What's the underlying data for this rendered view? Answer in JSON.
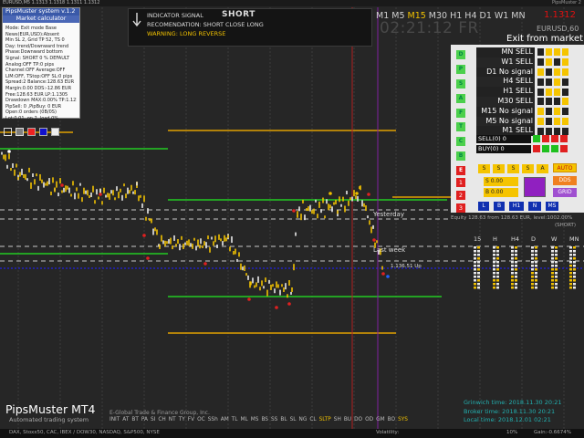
{
  "window": {
    "title_strip": "EURUSD,M5  1.1313 1.1318 1.1311 1.1312",
    "right_corner": "PipsMuster 2"
  },
  "info_panel": {
    "header_1": "PipsMuster system v.1.2",
    "header_2": "Market calculator",
    "lines": [
      "Mode: Exit mode Base",
      "News(EUR,USD):Absent",
      "Min SL 2, Grid TP 52, TS 0",
      "Day: trend/Downward trend",
      "Phase:Downward bottom",
      "Signal: SHORT 0 % DEFAULT",
      "Analog:OFF TP:0 pips",
      "Channel:OFF Average:OFF",
      "LIM:OFF, TStop:OFF SL:0 pips",
      "Spread:2 Balance:128.63 EUR",
      "Margin:0.00  DDS:-12.86 EUR",
      "Free:128.63 EUR LP:1.1305",
      "Drawdown MAX:0.00% TP:1.1255",
      "PipSell: 0 ,PipBuy: 0 EUR",
      "Open:0 orders (0B/0S)",
      "Lot:0.01, on 2, load 0%"
    ]
  },
  "signal_panel": {
    "signal_label": "INDICATOR SIGNAL",
    "signal_value": "SHORT",
    "recommendation": "RECOMENDATION: SHORT CLOSE LONG",
    "warning": "WARNING: LONG REVERSE"
  },
  "timeframes": [
    "M1",
    "M5",
    "M15",
    "M30",
    "H1",
    "H4",
    "D1",
    "W1",
    "MN"
  ],
  "active_timeframe": "M15",
  "price": "1.1312",
  "countdown": "02:21:12 FR",
  "symbol": "EURUSD,60",
  "exit_label": "Exit from market",
  "right_panel": {
    "letters": [
      "D",
      "P",
      "S",
      "A",
      "F",
      "T",
      "C",
      "B",
      "E"
    ],
    "rows": [
      {
        "label": "MN SELL",
        "dots": [
          "k",
          "y",
          "y",
          "y"
        ]
      },
      {
        "label": "W1 SELL",
        "dots": [
          "k",
          "y",
          "k",
          "y"
        ]
      },
      {
        "label": "D1 No signal",
        "dots": [
          "y",
          "k",
          "y",
          "y"
        ]
      },
      {
        "label": "H4 SELL",
        "dots": [
          "k",
          "k",
          "y",
          "k"
        ]
      },
      {
        "label": "H1 SELL",
        "dots": [
          "k",
          "y",
          "y",
          "k"
        ]
      },
      {
        "label": "M30 SELL",
        "dots": [
          "k",
          "k",
          "k",
          "y"
        ]
      },
      {
        "label": "M15 No signal",
        "dots": [
          "y",
          "k",
          "y",
          "k"
        ]
      },
      {
        "label": "M5 No signal",
        "dots": [
          "y",
          "k",
          "y",
          "y"
        ]
      },
      {
        "label": "M1 SELL",
        "dots": [
          "k",
          "k",
          "k",
          "k"
        ]
      }
    ],
    "sell_label": "SELL(0) 0",
    "buy_label": "BUY(0) 0",
    "sell_dots": [
      "g",
      "r",
      "r",
      "r"
    ],
    "buy_dots": [
      "r",
      "g",
      "g",
      "r"
    ],
    "yellow_buttons": [
      "S",
      "S",
      "S",
      "S",
      "A"
    ],
    "auto_label": "AUTO",
    "num_1": "1",
    "num_2": "2",
    "num_3": "3",
    "val_s": "S 0.00",
    "val_b": "B 0.00",
    "dds_label": "DDS",
    "grid_label": "GRID",
    "blue_buttons": [
      "L",
      "B",
      "H1",
      "N",
      "MS"
    ]
  },
  "equity": "Equity 128.63 from 128.63 EUR, level:1002.00%",
  "equity_sub": "(SHORT)",
  "mini_tf": [
    "15",
    "H",
    "H4",
    "D",
    "W",
    "MN"
  ],
  "chart_labels": {
    "yesterday": "Yesterday",
    "last_week": "Last week",
    "side_price": "1.136.51 Up",
    "markers": [
      "Zh",
      "1",
      "3",
      "S",
      "S",
      "P",
      "P",
      "S",
      "5%",
      "P",
      "P",
      "P",
      "Dp",
      "P"
    ]
  },
  "bottom": {
    "brand": "PipsMuster MT4",
    "subtitle": "Automated trading system",
    "company": "E-Global Trade & Finance Group, Inc.",
    "tags": [
      "INIT",
      "AT",
      "BT",
      "PA",
      "SI",
      "CH",
      "NT",
      "TY",
      "FV",
      "OC",
      "SSh",
      "AM",
      "TL",
      "ML",
      "MS",
      "BS",
      "SS",
      "BL",
      "SL",
      "NG",
      "CL",
      "SLTP",
      "SH",
      "BU",
      "DO",
      "OD",
      "GM",
      "BO",
      "SYS"
    ],
    "grinwich": "Grinwich time: 2018.11.30 20:21",
    "broker": "Broker time: 2018.11.30 20:21",
    "local": "Local time: 2018.12.01 02:21",
    "footer_text": "DAX, Stoxx50, CAC, IBEX / DOW30, NASDAQ, S&P500, NYSE",
    "volatility": "Volatility:",
    "pct": "10%",
    "gain": "Gain:-0.6674%"
  }
}
